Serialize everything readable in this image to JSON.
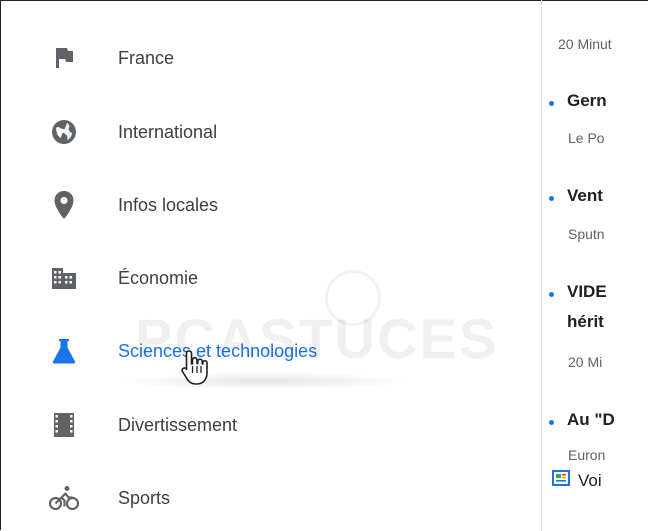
{
  "sidebar": {
    "items": [
      {
        "label": "France",
        "icon": "flag-icon",
        "active": false
      },
      {
        "label": "International",
        "icon": "globe-icon",
        "active": false
      },
      {
        "label": "Infos locales",
        "icon": "location-pin-icon",
        "active": false
      },
      {
        "label": "Économie",
        "icon": "building-icon",
        "active": false
      },
      {
        "label": "Sciences et technologies",
        "icon": "flask-icon",
        "active": true
      },
      {
        "label": "Divertissement",
        "icon": "film-icon",
        "active": false
      },
      {
        "label": "Sports",
        "icon": "bicycle-icon",
        "active": false
      }
    ]
  },
  "content": {
    "top_source": "20 Minut",
    "articles": [
      {
        "headline": "Gern",
        "source": "Le Po"
      },
      {
        "headline": "Vent",
        "source": "Sputn"
      },
      {
        "headline": "VIDE",
        "headline2": "hérit",
        "source": "20 Mi"
      },
      {
        "headline": "Au \"D",
        "source": "Euron"
      }
    ],
    "more_link": "Voi"
  },
  "watermark": "PCASTUCES",
  "colors": {
    "accent": "#1a73e8",
    "icon_gray": "#5f6368",
    "text": "#3c4043"
  }
}
